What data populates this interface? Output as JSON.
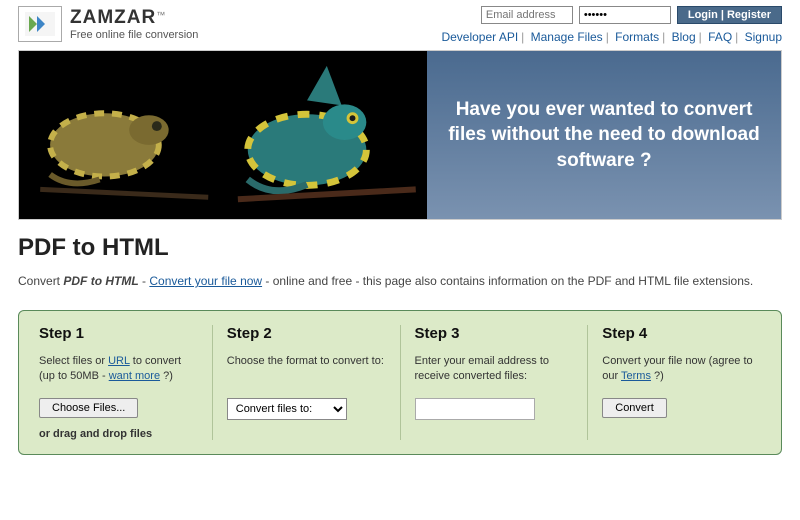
{
  "brand": {
    "name": "ZAMZAR",
    "tagline": "Free online file conversion",
    "tm": "™"
  },
  "login": {
    "email_placeholder": "Email address",
    "password_value": "••••••",
    "button": "Login  |  Register"
  },
  "nav": {
    "items": [
      "Developer API",
      "Manage Files",
      "Formats",
      "Blog",
      "FAQ",
      "Signup"
    ]
  },
  "hero": {
    "message": "Have you ever wanted to convert files without the need to download software ?"
  },
  "page": {
    "title": "PDF to HTML",
    "sub_prefix": "Convert ",
    "sub_em": "PDF to HTML",
    "sub_dash": " - ",
    "sub_link": "Convert your file now",
    "sub_rest": " - online and free - this page also contains information on the PDF and HTML file extensions."
  },
  "steps": [
    {
      "heading": "Step 1",
      "text_a": "Select files or ",
      "url_link": "URL",
      "text_b": " to convert (up to 50MB - ",
      "more_link": "want more",
      "text_c": " ?)",
      "choose_btn": "Choose Files...",
      "drag_hint": "or drag and drop files"
    },
    {
      "heading": "Step 2",
      "text": "Choose the format to convert to:",
      "select_label": "Convert files to:"
    },
    {
      "heading": "Step 3",
      "text": "Enter your email address to receive converted files:"
    },
    {
      "heading": "Step 4",
      "text_a": "Convert your file now (agree to our ",
      "terms_link": "Terms",
      "text_b": " ?)",
      "convert_btn": "Convert"
    }
  ]
}
